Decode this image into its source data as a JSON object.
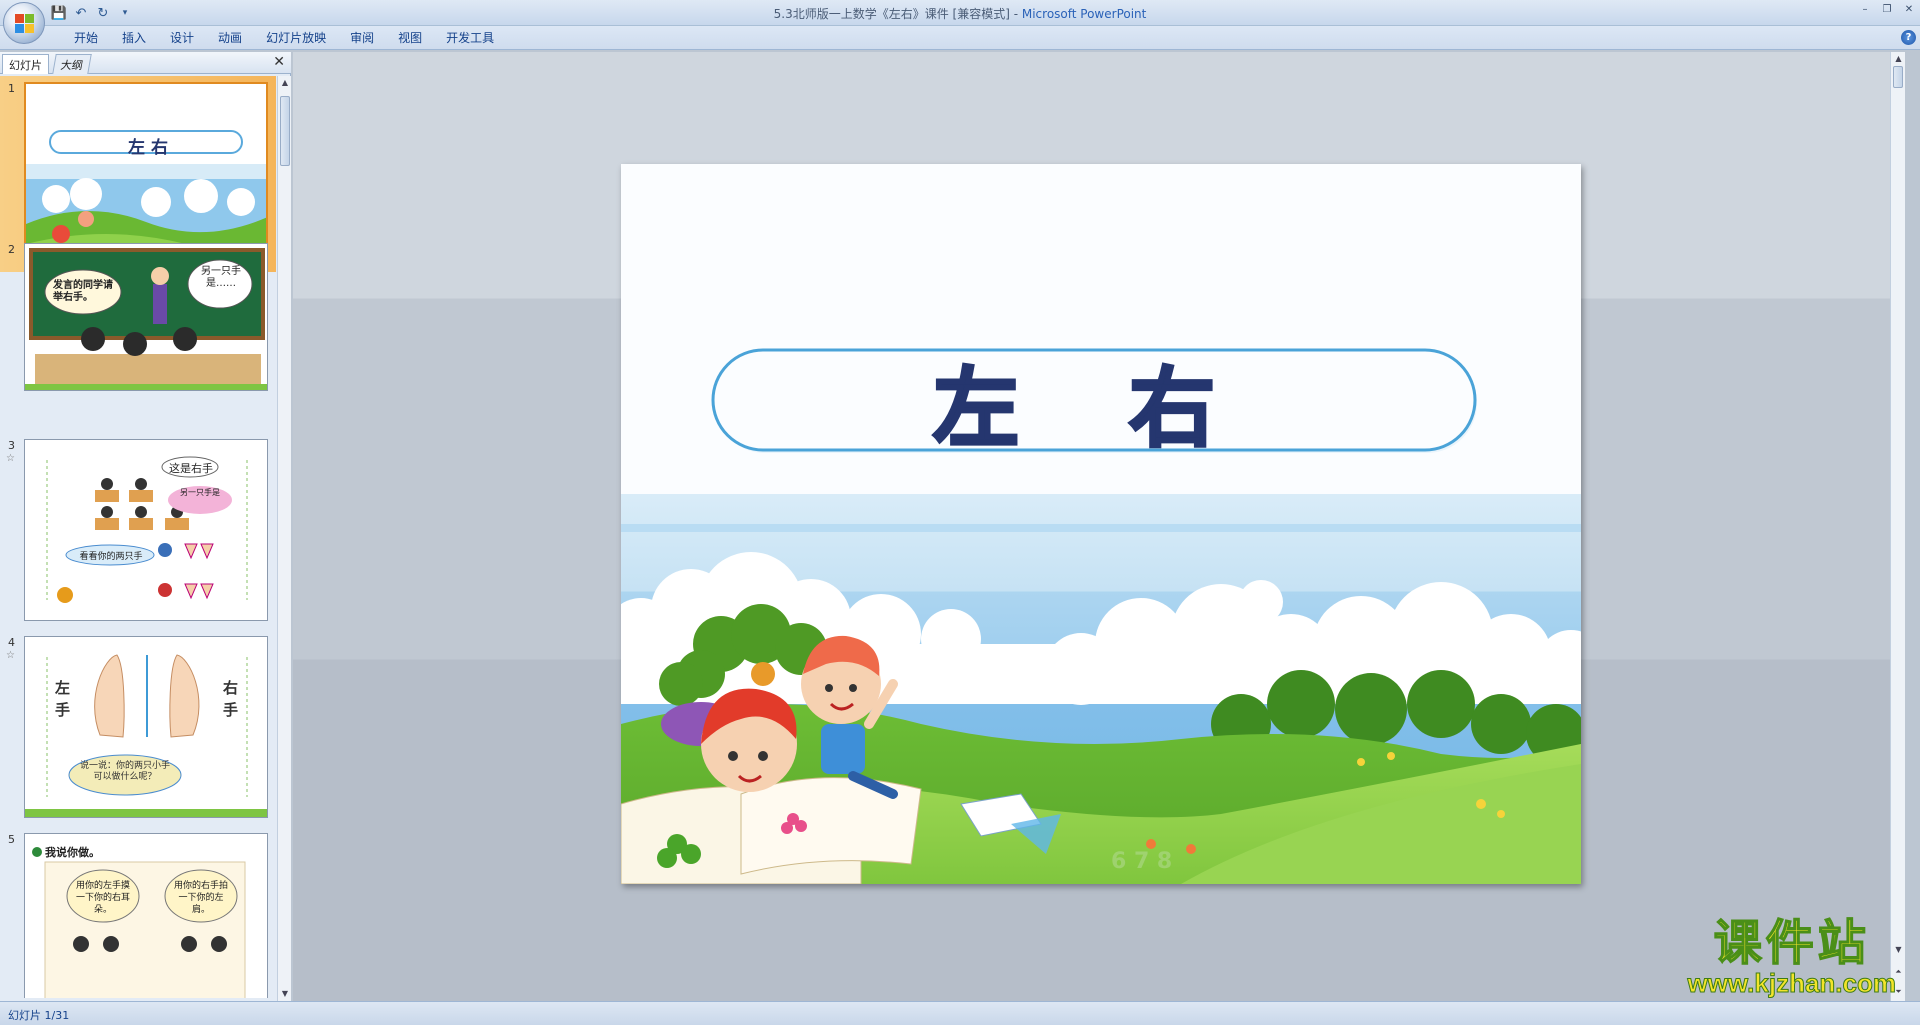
{
  "window": {
    "title": "5.3北师版一上数学《左右》课件 [兼容模式] - ",
    "app_name": "Microsoft PowerPoint",
    "controls": [
      "–",
      "❐",
      "✕"
    ]
  },
  "qat": {
    "icons": [
      "save-icon",
      "undo-icon",
      "redo-icon",
      "customize-qat-icon"
    ],
    "glyphs": [
      "💾",
      "↶",
      "↻",
      "▾"
    ]
  },
  "ribbon": {
    "tabs": [
      "开始",
      "插入",
      "设计",
      "动画",
      "幻灯片放映",
      "审阅",
      "视图",
      "开发工具"
    ],
    "help_glyph": "?"
  },
  "left_pane": {
    "tabs": [
      "幻灯片",
      "大纲"
    ],
    "close_glyph": "✕",
    "thumbnails": [
      {
        "num": "1",
        "title": "左 右",
        "selected": true
      },
      {
        "num": "2",
        "bubble_left": "发言的同学请举右手。",
        "bubble_right": "另一只手是……"
      },
      {
        "num": "3",
        "bubble_top": "这是右手",
        "bubble_mid": "另一只手是",
        "bubble_bottom": "看看你的两只手"
      },
      {
        "num": "4",
        "left_label": "左手",
        "right_label": "右手",
        "bubble": "说一说：你的两只小手可以做什么呢？"
      },
      {
        "num": "5",
        "heading": "我说你做。",
        "bubble_left": "用你的左手摸一下你的右耳朵。",
        "bubble_right": "用你的右手拍一下你的左肩。"
      }
    ]
  },
  "slide": {
    "title": "左 右"
  },
  "status": {
    "text": "幻灯片 1/31"
  },
  "watermark": {
    "big": "课件站",
    "url": "www.kjzhan.com"
  },
  "colors": {
    "title_text": "#25366f",
    "title_border": "#4aa3d8",
    "accent_orange": "#f5b55a"
  }
}
